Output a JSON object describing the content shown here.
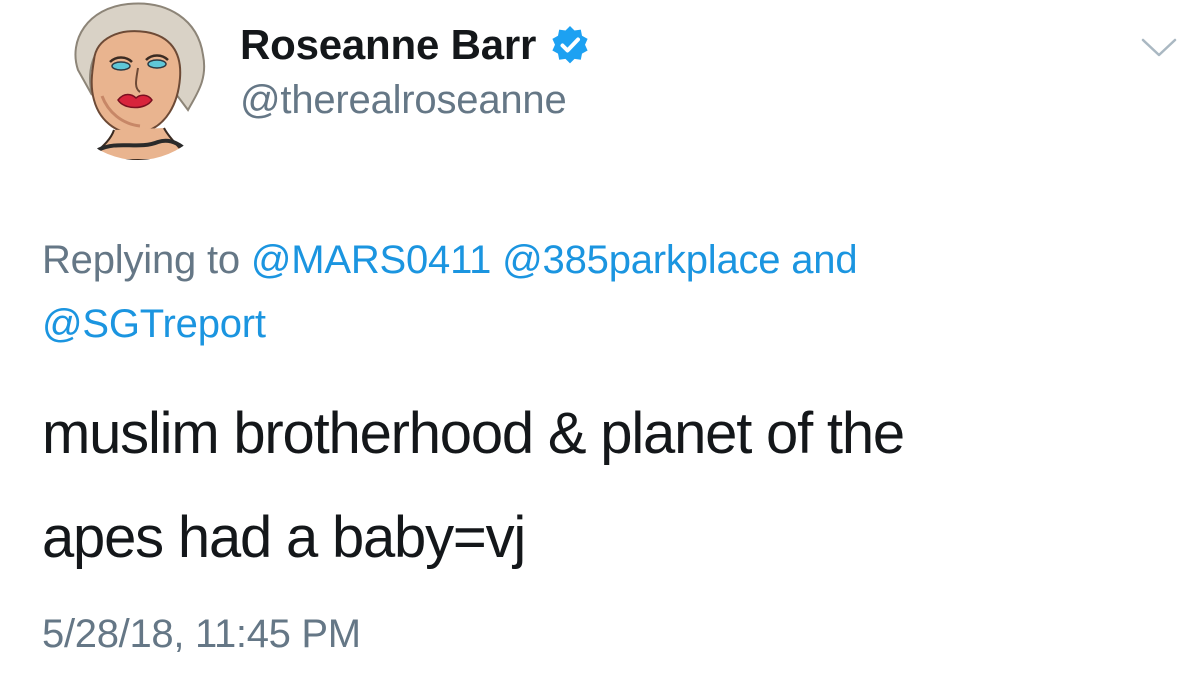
{
  "tweet": {
    "author": {
      "display_name": "Roseanne Barr",
      "handle": "@therealroseanne",
      "verified": true,
      "avatar_icon": "drawn-portrait-avatar"
    },
    "menu_icon": "chevron-down-icon",
    "reply_context": {
      "prefix": "Replying to",
      "mentions": [
        "@MARS0411",
        "@385parkplace",
        "@SGTreport"
      ],
      "conjunction": "and"
    },
    "text_lines": [
      "muslim brotherhood & planet of the",
      "apes had a baby=vj"
    ],
    "timestamp": "5/28/18, 11:45 PM"
  },
  "colors": {
    "text_primary": "#14171a",
    "text_secondary": "#657786",
    "link_blue": "#1b95e0",
    "verified_blue": "#1da1f2"
  }
}
